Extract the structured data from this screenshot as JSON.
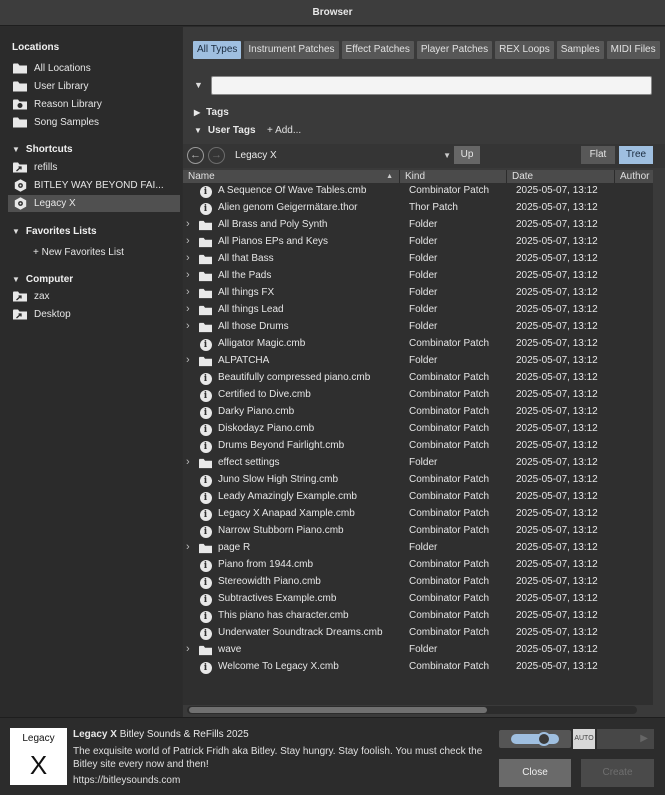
{
  "window": {
    "title": "Browser"
  },
  "sidebar": {
    "locations": {
      "heading": "Locations",
      "items": [
        {
          "label": "All Locations",
          "icon": "folder-icon"
        },
        {
          "label": "User Library",
          "icon": "folder-icon"
        },
        {
          "label": "Reason Library",
          "icon": "folder-reason-icon"
        },
        {
          "label": "Song Samples",
          "icon": "folder-icon"
        }
      ]
    },
    "shortcuts": {
      "heading": "Shortcuts",
      "items": [
        {
          "label": "refills",
          "icon": "shortcut-folder-icon"
        },
        {
          "label": "BITLEY WAY BEYOND FAI...",
          "icon": "refill-icon"
        },
        {
          "label": "Legacy X",
          "icon": "refill-icon",
          "selected": true
        }
      ]
    },
    "favorites": {
      "heading": "Favorites Lists",
      "new_label": "+ New Favorites List"
    },
    "computer": {
      "heading": "Computer",
      "items": [
        {
          "label": "zax",
          "icon": "shortcut-folder-icon"
        },
        {
          "label": "Desktop",
          "icon": "shortcut-folder-icon"
        }
      ]
    }
  },
  "filters": {
    "types": [
      "All Types",
      "Instrument Patches",
      "Effect Patches",
      "Player Patches",
      "REX Loops",
      "Samples",
      "MIDI Files"
    ],
    "active_type": "All Types",
    "search": {
      "value": "",
      "placeholder": ""
    },
    "tags_label": "Tags",
    "user_tags_label": "User Tags",
    "add_label": "+ Add..."
  },
  "pathbar": {
    "current": "Legacy X",
    "up_label": "Up",
    "flat_label": "Flat",
    "tree_label": "Tree",
    "view_mode": "Tree"
  },
  "table": {
    "columns": [
      "Name",
      "Kind",
      "Date",
      "Author"
    ],
    "sort_column": "Name",
    "rows": [
      {
        "name": "A Sequence Of Wave Tables.cmb",
        "kind": "Combinator Patch",
        "date": "2025-05-07, 13:12",
        "type": "file"
      },
      {
        "name": "Alien genom Geigermätare.thor",
        "kind": "Thor Patch",
        "date": "2025-05-07, 13:12",
        "type": "file"
      },
      {
        "name": "All Brass and Poly Synth",
        "kind": "Folder",
        "date": "2025-05-07, 13:12",
        "type": "folder"
      },
      {
        "name": "All Pianos EPs and Keys",
        "kind": "Folder",
        "date": "2025-05-07, 13:12",
        "type": "folder"
      },
      {
        "name": "All that Bass",
        "kind": "Folder",
        "date": "2025-05-07, 13:12",
        "type": "folder"
      },
      {
        "name": "All the Pads",
        "kind": "Folder",
        "date": "2025-05-07, 13:12",
        "type": "folder"
      },
      {
        "name": "All things FX",
        "kind": "Folder",
        "date": "2025-05-07, 13:12",
        "type": "folder"
      },
      {
        "name": "All things Lead",
        "kind": "Folder",
        "date": "2025-05-07, 13:12",
        "type": "folder"
      },
      {
        "name": "All those Drums",
        "kind": "Folder",
        "date": "2025-05-07, 13:12",
        "type": "folder"
      },
      {
        "name": "Alligator Magic.cmb",
        "kind": "Combinator Patch",
        "date": "2025-05-07, 13:12",
        "type": "file"
      },
      {
        "name": "ALPATCHA",
        "kind": "Folder",
        "date": "2025-05-07, 13:12",
        "type": "folder"
      },
      {
        "name": "Beautifully compressed piano.cmb",
        "kind": "Combinator Patch",
        "date": "2025-05-07, 13:12",
        "type": "file"
      },
      {
        "name": "Certified to Dive.cmb",
        "kind": "Combinator Patch",
        "date": "2025-05-07, 13:12",
        "type": "file"
      },
      {
        "name": "Darky Piano.cmb",
        "kind": "Combinator Patch",
        "date": "2025-05-07, 13:12",
        "type": "file"
      },
      {
        "name": "Diskodayz Piano.cmb",
        "kind": "Combinator Patch",
        "date": "2025-05-07, 13:12",
        "type": "file"
      },
      {
        "name": "Drums Beyond Fairlight.cmb",
        "kind": "Combinator Patch",
        "date": "2025-05-07, 13:12",
        "type": "file"
      },
      {
        "name": "effect settings",
        "kind": "Folder",
        "date": "2025-05-07, 13:12",
        "type": "folder"
      },
      {
        "name": "Juno Slow High String.cmb",
        "kind": "Combinator Patch",
        "date": "2025-05-07, 13:12",
        "type": "file"
      },
      {
        "name": "Leady Amazingly Example.cmb",
        "kind": "Combinator Patch",
        "date": "2025-05-07, 13:12",
        "type": "file"
      },
      {
        "name": "Legacy X Anapad Xample.cmb",
        "kind": "Combinator Patch",
        "date": "2025-05-07, 13:12",
        "type": "file"
      },
      {
        "name": "Narrow Stubborn Piano.cmb",
        "kind": "Combinator Patch",
        "date": "2025-05-07, 13:12",
        "type": "file"
      },
      {
        "name": "page R",
        "kind": "Folder",
        "date": "2025-05-07, 13:12",
        "type": "folder"
      },
      {
        "name": "Piano from 1944.cmb",
        "kind": "Combinator Patch",
        "date": "2025-05-07, 13:12",
        "type": "file"
      },
      {
        "name": "Stereowidth Piano.cmb",
        "kind": "Combinator Patch",
        "date": "2025-05-07, 13:12",
        "type": "file"
      },
      {
        "name": "Subtractives Example.cmb",
        "kind": "Combinator Patch",
        "date": "2025-05-07, 13:12",
        "type": "file"
      },
      {
        "name": "This piano has character.cmb",
        "kind": "Combinator Patch",
        "date": "2025-05-07, 13:12",
        "type": "file"
      },
      {
        "name": "Underwater Soundtrack Dreams.cmb",
        "kind": "Combinator Patch",
        "date": "2025-05-07, 13:12",
        "type": "file"
      },
      {
        "name": "wave",
        "kind": "Folder",
        "date": "2025-05-07, 13:12",
        "type": "folder"
      },
      {
        "name": "Welcome To Legacy X.cmb",
        "kind": "Combinator Patch",
        "date": "2025-05-07, 13:12",
        "type": "file"
      }
    ]
  },
  "info": {
    "thumb_top": "Legacy",
    "thumb_big": "X",
    "title": "Legacy X",
    "subtitle": "Bitley Sounds & ReFills 2025",
    "description": "The exquisite world of Patrick Fridh aka Bitley. Stay hungry. Stay foolish. You must check the Bitley site every now and then!",
    "link": "https://bitleysounds.com"
  },
  "buttons": {
    "auto_label": "AUTO",
    "close_label": "Close",
    "create_label": "Create"
  },
  "colors": {
    "accent": "#9fbfe0",
    "background": "#2c2c2c",
    "panel": "#3a3a3a"
  }
}
